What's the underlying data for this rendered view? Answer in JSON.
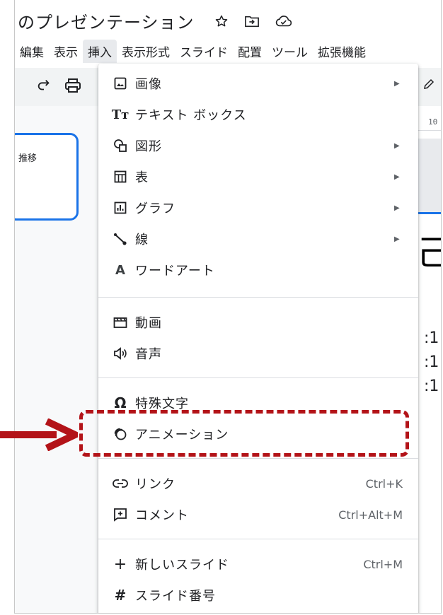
{
  "window": {
    "title": "のプレゼンテーション",
    "title_icons": [
      "star-icon",
      "move-to-folder-icon",
      "cloud-saved-icon"
    ]
  },
  "menubar": {
    "items": [
      "編集",
      "表示",
      "挿入",
      "表示形式",
      "スライド",
      "配置",
      "ツール",
      "拡張機能"
    ],
    "active": "挿入"
  },
  "toolbar": {
    "icons": [
      "redo-icon",
      "print-icon",
      "pen-icon"
    ]
  },
  "slide_panel": {
    "thumb_text": "推移"
  },
  "canvas": {
    "ruler_tick": "10",
    "big_glyph": "己",
    "lines": [
      ":1",
      ":1",
      ":1"
    ]
  },
  "insert_menu": {
    "groups": [
      [
        {
          "label": "画像",
          "icon": "image-icon",
          "submenu": true
        },
        {
          "label": "テキスト ボックス",
          "icon": "text-box-icon",
          "submenu": false
        },
        {
          "label": "図形",
          "icon": "shapes-icon",
          "submenu": true
        },
        {
          "label": "表",
          "icon": "table-icon",
          "submenu": true
        },
        {
          "label": "グラフ",
          "icon": "chart-icon",
          "submenu": true
        },
        {
          "label": "線",
          "icon": "line-icon",
          "submenu": true
        },
        {
          "label": "ワードアート",
          "icon": "word-art-icon",
          "submenu": false
        }
      ],
      [
        {
          "label": "動画",
          "icon": "video-icon"
        },
        {
          "label": "音声",
          "icon": "audio-icon"
        }
      ],
      [
        {
          "label": "特殊文字",
          "icon": "special-chars-icon"
        },
        {
          "label": "アニメーション",
          "icon": "animation-icon",
          "highlighted": true
        }
      ],
      [
        {
          "label": "リンク",
          "icon": "link-icon",
          "shortcut": "Ctrl+K"
        },
        {
          "label": "コメント",
          "icon": "comment-icon",
          "shortcut": "Ctrl+Alt+M"
        }
      ],
      [
        {
          "label": "新しいスライド",
          "icon": "plus-icon",
          "shortcut": "Ctrl+M"
        },
        {
          "label": "スライド番号",
          "icon": "hash-icon"
        }
      ]
    ],
    "submenu_arrow": "▶"
  },
  "annotation": {
    "color": "#b31318"
  }
}
